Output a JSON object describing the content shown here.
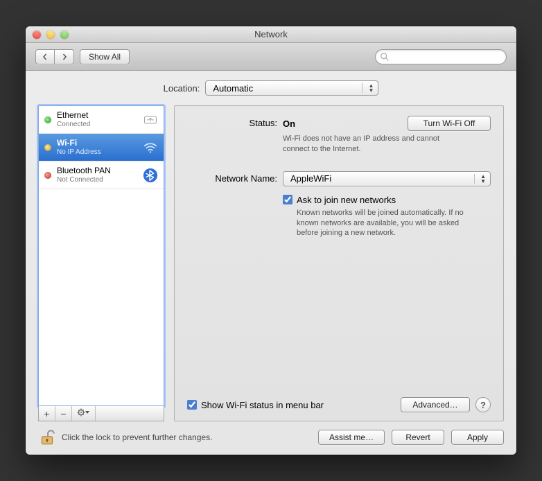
{
  "title": "Network",
  "toolbar": {
    "show_all": "Show All",
    "search_placeholder": ""
  },
  "location": {
    "label": "Location:",
    "value": "Automatic"
  },
  "services": [
    {
      "name": "Ethernet",
      "status_text": "Connected",
      "dot": "green",
      "icon": "ethernet"
    },
    {
      "name": "Wi-Fi",
      "status_text": "No IP Address",
      "dot": "yellow",
      "icon": "wifi",
      "selected": true
    },
    {
      "name": "Bluetooth PAN",
      "status_text": "Not Connected",
      "dot": "red",
      "icon": "bluetooth"
    }
  ],
  "listbar": {
    "add": "+",
    "remove": "−",
    "gear": "✻▾"
  },
  "detail": {
    "status_label": "Status:",
    "status_value": "On",
    "wifi_btn": "Turn Wi-Fi Off",
    "status_hint": "Wi-Fi does not have an IP address and cannot connect to the Internet.",
    "network_label": "Network Name:",
    "network_value": "AppleWiFi",
    "ask_label": "Ask to join new networks",
    "ask_hint": "Known networks will be joined automatically. If no known networks are available, you will be asked before joining a new network.",
    "show_menu": "Show Wi-Fi status in menu bar",
    "advanced": "Advanced…",
    "help": "?"
  },
  "footer": {
    "lock_text": "Click the lock to prevent further changes.",
    "assist": "Assist me…",
    "revert": "Revert",
    "apply": "Apply"
  }
}
